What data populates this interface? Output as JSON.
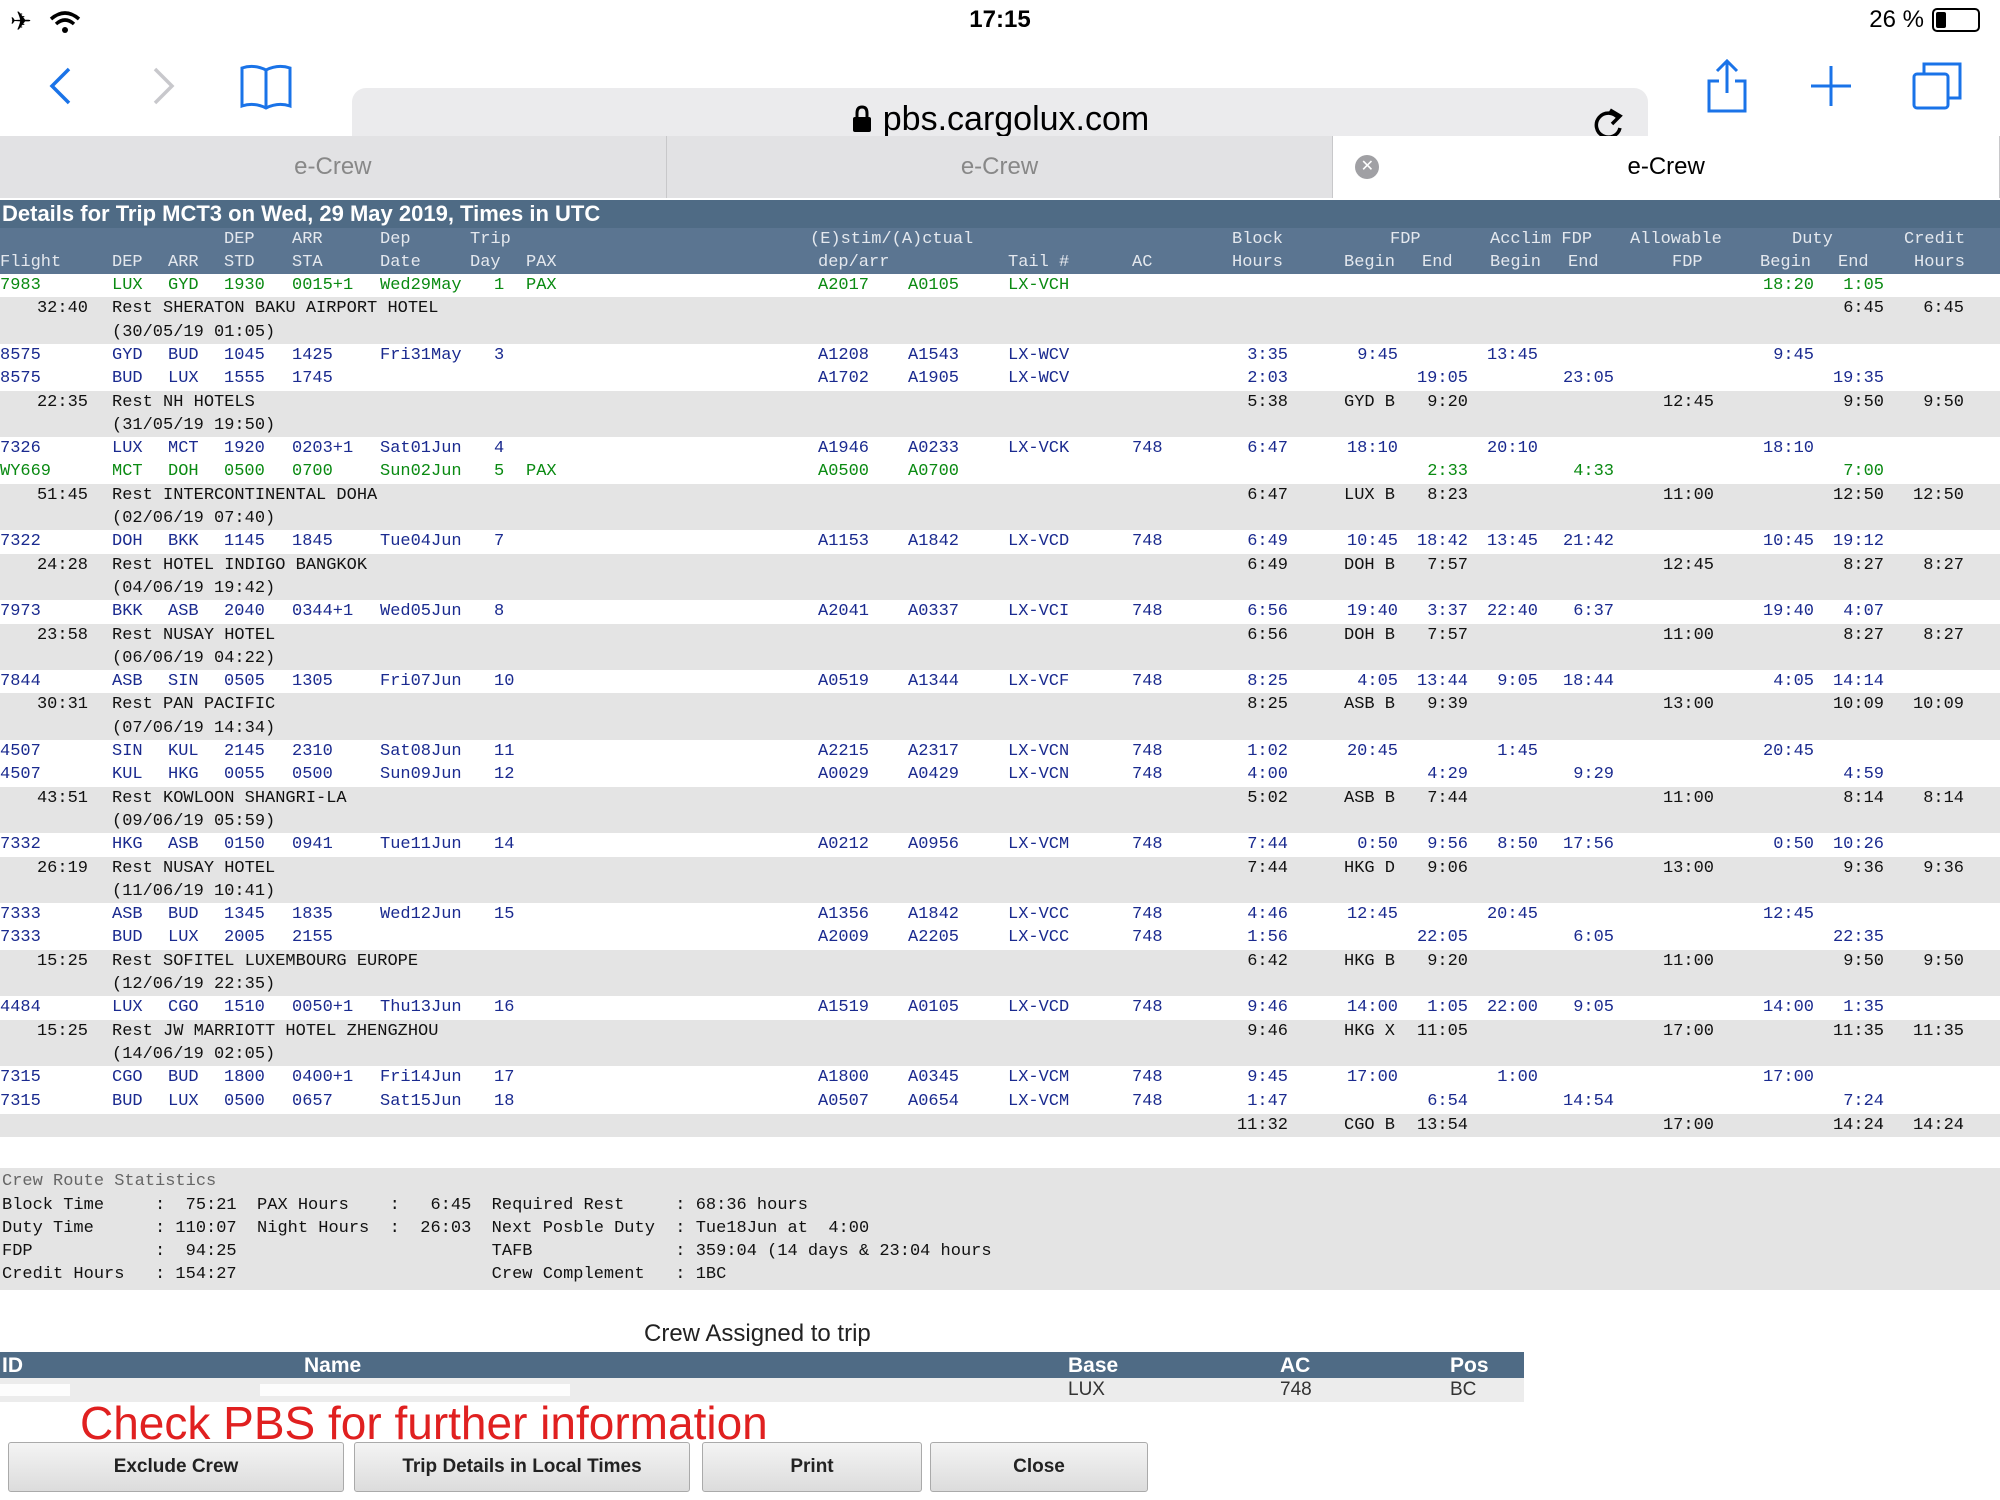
{
  "status": {
    "time": "17:15",
    "battery": "26 %",
    "battery_level": 0.26
  },
  "browser": {
    "url": "pbs.cargolux.com",
    "tabs": [
      "e-Crew",
      "e-Crew",
      "e-Crew"
    ],
    "active_tab": 2
  },
  "icons": {
    "airplane": "airplane-icon",
    "wifi": "wifi-icon",
    "back": "chevron-left-icon",
    "forward": "chevron-right-icon",
    "bookmarks": "book-icon",
    "lock": "lock-icon",
    "reload": "reload-icon",
    "share": "share-icon",
    "add": "plus-icon",
    "tabs": "tabs-icon",
    "close_tab": "close-tab-icon"
  },
  "colors": {
    "header_bg": "#4f6b85",
    "flight_text": "#1a2a8f",
    "pax_text": "#0a8a12",
    "rest_bg": "#e4e4e4",
    "check_text": "#e02020"
  },
  "page": {
    "title": "Details for Trip MCT3 on Wed, 29 May 2019, Times in UTC"
  },
  "header": {
    "row1": {
      "dep": "DEP",
      "arr": "ARR",
      "dep_date": "Dep",
      "trip": "Trip",
      "estim": "(E)stim/(A)ctual",
      "block": "Block",
      "fdp": "FDP",
      "acclim": "Acclim FDP",
      "allowable": "Allowable",
      "duty": "Duty",
      "credit": "Credit"
    },
    "row2": {
      "flight": "Flight",
      "dep": "DEP",
      "arr": "ARR",
      "std": "STD",
      "sta": "STA",
      "date": "Date",
      "day": "Day",
      "pax": "PAX",
      "deparr": "dep/arr",
      "tail": "Tail #",
      "ac": "AC",
      "hours": "Hours",
      "fdp_begin": "Begin",
      "fdp_end": "End",
      "acc_begin": "Begin",
      "acc_end": "End",
      "allow_fdp": "FDP",
      "duty_begin": "Begin",
      "duty_end": "End",
      "credit_hours": "Hours"
    }
  },
  "rows": [
    {
      "type": "flight",
      "green": true,
      "flight": "7983",
      "dep": "LUX",
      "arr": "GYD",
      "std": "1930",
      "sta": "0015+1",
      "date": "Wed29May",
      "day": "1",
      "pax": "PAX",
      "ed": "A2017",
      "ea": "A0105",
      "tail": "LX-VCH",
      "ac": "",
      "block": "",
      "fdp_b": "",
      "fdp_e": "",
      "acc_b": "",
      "acc_e": "",
      "allow": "",
      "duty_b": "18:20",
      "duty_e": "1:05",
      "credit": ""
    },
    {
      "type": "rest",
      "dur": "32:40",
      "text": "Rest SHERATON BAKU AIRPORT HOTEL",
      "block": "",
      "fdp_b": "",
      "fdp_e": "",
      "allow": "",
      "duty_b": "",
      "duty_e": "6:45",
      "credit": "6:45"
    },
    {
      "type": "sub",
      "text": "(30/05/19 01:05)"
    },
    {
      "type": "flight",
      "flight": "8575",
      "dep": "GYD",
      "arr": "BUD",
      "std": "1045",
      "sta": "1425",
      "date": "Fri31May",
      "day": "3",
      "pax": "",
      "ed": "A1208",
      "ea": "A1543",
      "tail": "LX-WCV",
      "ac": "",
      "block": "3:35",
      "fdp_b": "9:45",
      "fdp_e": "",
      "acc_b": "13:45",
      "acc_e": "",
      "allow": "",
      "duty_b": "9:45",
      "duty_e": "",
      "credit": ""
    },
    {
      "type": "flight",
      "flight": "8575",
      "dep": "BUD",
      "arr": "LUX",
      "std": "1555",
      "sta": "1745",
      "date": "",
      "day": "",
      "pax": "",
      "ed": "A1702",
      "ea": "A1905",
      "tail": "LX-WCV",
      "ac": "",
      "block": "2:03",
      "fdp_b": "",
      "fdp_e": "19:05",
      "acc_b": "",
      "acc_e": "23:05",
      "allow": "",
      "duty_b": "",
      "duty_e": "19:35",
      "credit": ""
    },
    {
      "type": "rest",
      "dur": "22:35",
      "text": "Rest NH HOTELS",
      "block": "5:38",
      "fdp_b": "GYD B",
      "fdp_e": "9:20",
      "allow": "12:45",
      "duty_b": "",
      "duty_e": "9:50",
      "credit": "9:50"
    },
    {
      "type": "sub",
      "text": "(31/05/19 19:50)"
    },
    {
      "type": "flight",
      "flight": "7326",
      "dep": "LUX",
      "arr": "MCT",
      "std": "1920",
      "sta": "0203+1",
      "date": "Sat01Jun",
      "day": "4",
      "pax": "",
      "ed": "A1946",
      "ea": "A0233",
      "tail": "LX-VCK",
      "ac": "748",
      "block": "6:47",
      "fdp_b": "18:10",
      "fdp_e": "",
      "acc_b": "20:10",
      "acc_e": "",
      "allow": "",
      "duty_b": "18:10",
      "duty_e": "",
      "credit": ""
    },
    {
      "type": "flight",
      "green": true,
      "flight": "WY669",
      "dep": "MCT",
      "arr": "DOH",
      "std": "0500",
      "sta": "0700",
      "date": "Sun02Jun",
      "day": "5",
      "pax": "PAX",
      "ed": "A0500",
      "ea": "A0700",
      "tail": "",
      "ac": "",
      "block": "",
      "fdp_b": "",
      "fdp_e": "2:33",
      "acc_b": "",
      "acc_e": "4:33",
      "allow": "",
      "duty_b": "",
      "duty_e": "7:00",
      "credit": ""
    },
    {
      "type": "rest",
      "dur": "51:45",
      "text": "Rest INTERCONTINENTAL DOHA",
      "block": "6:47",
      "fdp_b": "LUX B",
      "fdp_e": "8:23",
      "allow": "11:00",
      "duty_b": "",
      "duty_e": "12:50",
      "credit": "12:50"
    },
    {
      "type": "sub",
      "text": "(02/06/19 07:40)"
    },
    {
      "type": "flight",
      "flight": "7322",
      "dep": "DOH",
      "arr": "BKK",
      "std": "1145",
      "sta": "1845",
      "date": "Tue04Jun",
      "day": "7",
      "pax": "",
      "ed": "A1153",
      "ea": "A1842",
      "tail": "LX-VCD",
      "ac": "748",
      "block": "6:49",
      "fdp_b": "10:45",
      "fdp_e": "18:42",
      "acc_b": "13:45",
      "acc_e": "21:42",
      "allow": "",
      "duty_b": "10:45",
      "duty_e": "19:12",
      "credit": ""
    },
    {
      "type": "rest",
      "dur": "24:28",
      "text": "Rest HOTEL INDIGO BANGKOK",
      "block": "6:49",
      "fdp_b": "DOH B",
      "fdp_e": "7:57",
      "allow": "12:45",
      "duty_b": "",
      "duty_e": "8:27",
      "credit": "8:27"
    },
    {
      "type": "sub",
      "text": "(04/06/19 19:42)"
    },
    {
      "type": "flight",
      "flight": "7973",
      "dep": "BKK",
      "arr": "ASB",
      "std": "2040",
      "sta": "0344+1",
      "date": "Wed05Jun",
      "day": "8",
      "pax": "",
      "ed": "A2041",
      "ea": "A0337",
      "tail": "LX-VCI",
      "ac": "748",
      "block": "6:56",
      "fdp_b": "19:40",
      "fdp_e": "3:37",
      "acc_b": "22:40",
      "acc_e": "6:37",
      "allow": "",
      "duty_b": "19:40",
      "duty_e": "4:07",
      "credit": ""
    },
    {
      "type": "rest",
      "dur": "23:58",
      "text": "Rest NUSAY HOTEL",
      "block": "6:56",
      "fdp_b": "DOH B",
      "fdp_e": "7:57",
      "allow": "11:00",
      "duty_b": "",
      "duty_e": "8:27",
      "credit": "8:27"
    },
    {
      "type": "sub",
      "text": "(06/06/19 04:22)"
    },
    {
      "type": "flight",
      "flight": "7844",
      "dep": "ASB",
      "arr": "SIN",
      "std": "0505",
      "sta": "1305",
      "date": "Fri07Jun",
      "day": "10",
      "pax": "",
      "ed": "A0519",
      "ea": "A1344",
      "tail": "LX-VCF",
      "ac": "748",
      "block": "8:25",
      "fdp_b": "4:05",
      "fdp_e": "13:44",
      "acc_b": "9:05",
      "acc_e": "18:44",
      "allow": "",
      "duty_b": "4:05",
      "duty_e": "14:14",
      "credit": ""
    },
    {
      "type": "rest",
      "dur": "30:31",
      "text": "Rest PAN PACIFIC",
      "block": "8:25",
      "fdp_b": "ASB B",
      "fdp_e": "9:39",
      "allow": "13:00",
      "duty_b": "",
      "duty_e": "10:09",
      "credit": "10:09"
    },
    {
      "type": "sub",
      "text": "(07/06/19 14:34)"
    },
    {
      "type": "flight",
      "flight": "4507",
      "dep": "SIN",
      "arr": "KUL",
      "std": "2145",
      "sta": "2310",
      "date": "Sat08Jun",
      "day": "11",
      "pax": "",
      "ed": "A2215",
      "ea": "A2317",
      "tail": "LX-VCN",
      "ac": "748",
      "block": "1:02",
      "fdp_b": "20:45",
      "fdp_e": "",
      "acc_b": "1:45",
      "acc_e": "",
      "allow": "",
      "duty_b": "20:45",
      "duty_e": "",
      "credit": ""
    },
    {
      "type": "flight",
      "flight": "4507",
      "dep": "KUL",
      "arr": "HKG",
      "std": "0055",
      "sta": "0500",
      "date": "Sun09Jun",
      "day": "12",
      "pax": "",
      "ed": "A0029",
      "ea": "A0429",
      "tail": "LX-VCN",
      "ac": "748",
      "block": "4:00",
      "fdp_b": "",
      "fdp_e": "4:29",
      "acc_b": "",
      "acc_e": "9:29",
      "allow": "",
      "duty_b": "",
      "duty_e": "4:59",
      "credit": ""
    },
    {
      "type": "rest",
      "dur": "43:51",
      "text": "Rest KOWLOON SHANGRI-LA",
      "block": "5:02",
      "fdp_b": "ASB B",
      "fdp_e": "7:44",
      "allow": "11:00",
      "duty_b": "",
      "duty_e": "8:14",
      "credit": "8:14"
    },
    {
      "type": "sub",
      "text": "(09/06/19 05:59)"
    },
    {
      "type": "flight",
      "flight": "7332",
      "dep": "HKG",
      "arr": "ASB",
      "std": "0150",
      "sta": "0941",
      "date": "Tue11Jun",
      "day": "14",
      "pax": "",
      "ed": "A0212",
      "ea": "A0956",
      "tail": "LX-VCM",
      "ac": "748",
      "block": "7:44",
      "fdp_b": "0:50",
      "fdp_e": "9:56",
      "acc_b": "8:50",
      "acc_e": "17:56",
      "allow": "",
      "duty_b": "0:50",
      "duty_e": "10:26",
      "credit": ""
    },
    {
      "type": "rest",
      "dur": "26:19",
      "text": "Rest NUSAY HOTEL",
      "block": "7:44",
      "fdp_b": "HKG D",
      "fdp_e": "9:06",
      "allow": "13:00",
      "duty_b": "",
      "duty_e": "9:36",
      "credit": "9:36"
    },
    {
      "type": "sub",
      "text": "(11/06/19 10:41)"
    },
    {
      "type": "flight",
      "flight": "7333",
      "dep": "ASB",
      "arr": "BUD",
      "std": "1345",
      "sta": "1835",
      "date": "Wed12Jun",
      "day": "15",
      "pax": "",
      "ed": "A1356",
      "ea": "A1842",
      "tail": "LX-VCC",
      "ac": "748",
      "block": "4:46",
      "fdp_b": "12:45",
      "fdp_e": "",
      "acc_b": "20:45",
      "acc_e": "",
      "allow": "",
      "duty_b": "12:45",
      "duty_e": "",
      "credit": ""
    },
    {
      "type": "flight",
      "flight": "7333",
      "dep": "BUD",
      "arr": "LUX",
      "std": "2005",
      "sta": "2155",
      "date": "",
      "day": "",
      "pax": "",
      "ed": "A2009",
      "ea": "A2205",
      "tail": "LX-VCC",
      "ac": "748",
      "block": "1:56",
      "fdp_b": "",
      "fdp_e": "22:05",
      "acc_b": "",
      "acc_e": "6:05",
      "allow": "",
      "duty_b": "",
      "duty_e": "22:35",
      "credit": ""
    },
    {
      "type": "rest",
      "dur": "15:25",
      "text": "Rest SOFITEL LUXEMBOURG EUROPE",
      "block": "6:42",
      "fdp_b": "HKG B",
      "fdp_e": "9:20",
      "allow": "11:00",
      "duty_b": "",
      "duty_e": "9:50",
      "credit": "9:50"
    },
    {
      "type": "sub",
      "text": "(12/06/19 22:35)"
    },
    {
      "type": "flight",
      "flight": "4484",
      "dep": "LUX",
      "arr": "CGO",
      "std": "1510",
      "sta": "0050+1",
      "date": "Thu13Jun",
      "day": "16",
      "pax": "",
      "ed": "A1519",
      "ea": "A0105",
      "tail": "LX-VCD",
      "ac": "748",
      "block": "9:46",
      "fdp_b": "14:00",
      "fdp_e": "1:05",
      "acc_b": "22:00",
      "acc_e": "9:05",
      "allow": "",
      "duty_b": "14:00",
      "duty_e": "1:35",
      "credit": ""
    },
    {
      "type": "rest",
      "dur": "15:25",
      "text": "Rest JW MARRIOTT HOTEL ZHENGZHOU",
      "block": "9:46",
      "fdp_b": "HKG X",
      "fdp_e": "11:05",
      "allow": "17:00",
      "duty_b": "",
      "duty_e": "11:35",
      "credit": "11:35"
    },
    {
      "type": "sub",
      "text": "(14/06/19 02:05)"
    },
    {
      "type": "flight",
      "flight": "7315",
      "dep": "CGO",
      "arr": "BUD",
      "std": "1800",
      "sta": "0400+1",
      "date": "Fri14Jun",
      "day": "17",
      "pax": "",
      "ed": "A1800",
      "ea": "A0345",
      "tail": "LX-VCM",
      "ac": "748",
      "block": "9:45",
      "fdp_b": "17:00",
      "fdp_e": "",
      "acc_b": "1:00",
      "acc_e": "",
      "allow": "",
      "duty_b": "17:00",
      "duty_e": "",
      "credit": ""
    },
    {
      "type": "flight",
      "flight": "7315",
      "dep": "BUD",
      "arr": "LUX",
      "std": "0500",
      "sta": "0657",
      "date": "Sat15Jun",
      "day": "18",
      "pax": "",
      "ed": "A0507",
      "ea": "A0654",
      "tail": "LX-VCM",
      "ac": "748",
      "block": "1:47",
      "fdp_b": "",
      "fdp_e": "6:54",
      "acc_b": "",
      "acc_e": "14:54",
      "allow": "",
      "duty_b": "",
      "duty_e": "7:24",
      "credit": ""
    }
  ],
  "total": {
    "block": "11:32",
    "fdp_b": "CGO B",
    "fdp_e": "13:54",
    "allow": "17:00",
    "duty_e": "14:24",
    "credit": "14:24"
  },
  "stats": {
    "title": "Crew Route Statistics",
    "lines": [
      "Block Time     :  75:21  PAX Hours    :   6:45  Required Rest     : 68:36 hours",
      "Duty Time      : 110:07  Night Hours  :  26:03  Next Posble Duty  : Tue18Jun at  4:00",
      "FDP            :  94:25                         TAFB              : 359:04 (14 days & 23:04 hours",
      "Credit Hours   : 154:27                         Crew Complement   : 1BC"
    ]
  },
  "crew": {
    "title": "Crew Assigned to trip",
    "headers": {
      "id": "ID",
      "name": "Name",
      "base": "Base",
      "ac": "AC",
      "pos": "Pos"
    },
    "row": {
      "base": "LUX",
      "ac": "748",
      "pos": "BC"
    }
  },
  "note": "Check PBS for further information",
  "buttons": {
    "exclude": "Exclude Crew",
    "local": "Trip Details in Local Times",
    "print": "Print",
    "close": "Close"
  }
}
